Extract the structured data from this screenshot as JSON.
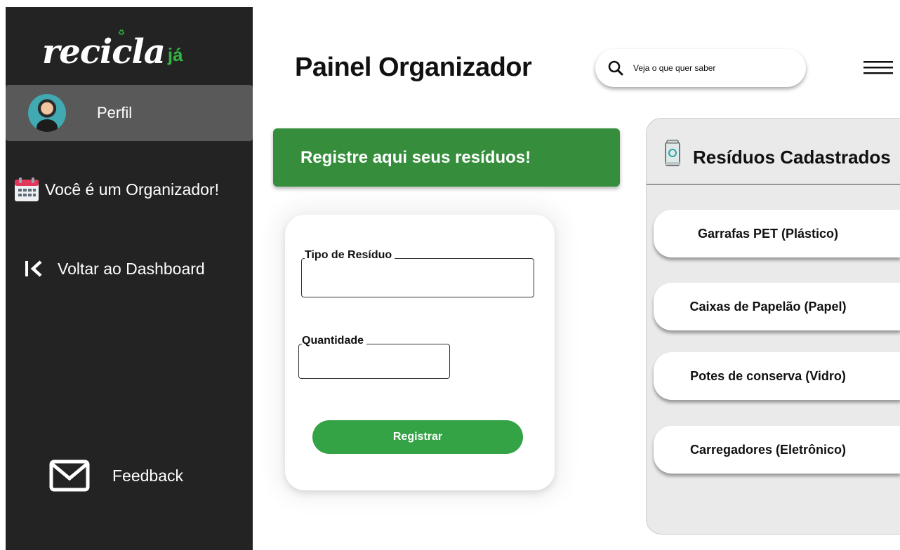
{
  "sidebar": {
    "logo_main": "recicla",
    "logo_accent": "já",
    "profile_label": "Perfil",
    "role_label": "Você é um Organizador!",
    "back_label": "Voltar ao Dashboard",
    "feedback_label": "Feedback"
  },
  "header": {
    "title": "Painel Organizador",
    "search_placeholder": "Veja o que quer saber"
  },
  "banner": {
    "text": "Registre aqui seus resíduos!"
  },
  "form": {
    "type_label": "Tipo de Resíduo",
    "type_value": "",
    "quantity_label": "Quantidade",
    "quantity_value": "",
    "submit_label": "Registrar"
  },
  "panel": {
    "title": "Resíduos Cadastrados",
    "items": [
      "Garrafas PET (Plástico)",
      "Caixas de Papelão (Papel)",
      "Potes de conserva (Vidro)",
      "Carregadores (Eletrônico)"
    ]
  },
  "colors": {
    "sidebar_bg": "#232323",
    "accent_green": "#33b542",
    "banner_green": "#368e3d",
    "button_green": "#34a345",
    "panel_bg": "#ebeaea"
  },
  "icons": {
    "logo_spark": "recycle-icon",
    "role": "calendar-icon",
    "back": "chevron-left-bar-icon",
    "feedback": "mail-icon",
    "search": "search-icon",
    "menu": "hamburger-menu-icon",
    "panel": "can-icon"
  }
}
